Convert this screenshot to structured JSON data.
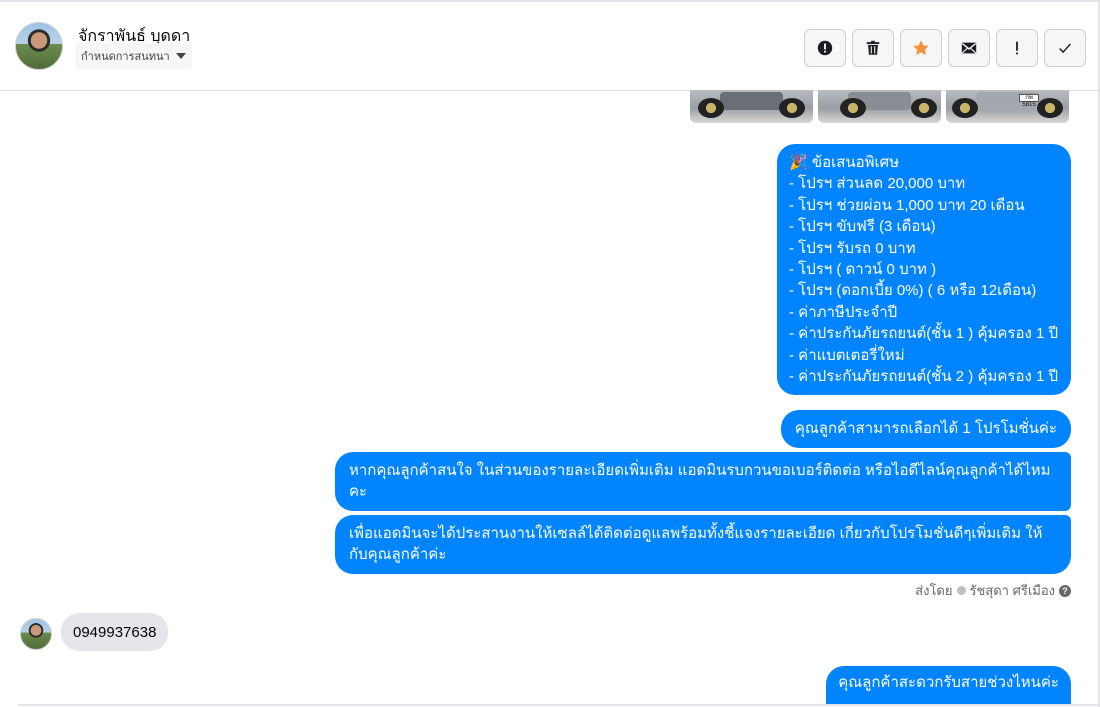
{
  "header": {
    "contact_name": "จักราพันธ์ บุดดา",
    "assign_label": "กำหนดการสนทนา",
    "actions": [
      {
        "name": "spam-button",
        "icon": "alert-circle-icon"
      },
      {
        "name": "delete-button",
        "icon": "trash-icon"
      },
      {
        "name": "star-button",
        "icon": "star-icon"
      },
      {
        "name": "mark-unread-button",
        "icon": "envelope-icon"
      },
      {
        "name": "follow-up-button",
        "icon": "exclamation-icon"
      },
      {
        "name": "done-button",
        "icon": "check-icon"
      }
    ]
  },
  "colors": {
    "outgoing_bubble": "#0084ff",
    "incoming_bubble": "#e4e6eb",
    "star": "#f7923a"
  },
  "offer_message": {
    "lines": [
      "🎉 ข้อเสนอพิเศษ",
      "- โปรฯ ส่วนลด 20,000 บาท",
      "- โปรฯ ช่วยผ่อน 1,000 บาท 20 เดือน",
      "- โปรฯ ขับฟรี (3 เดือน)",
      "- โปรฯ รับรถ 0 บาท",
      "- โปรฯ ( ดาวน์ 0 บาท )",
      "- โปรฯ (ดอกเบี้ย 0%) ( 6 หรือ 12เดือน)",
      "- ค่าภาษีประจำปี",
      "- ค่าประกันภัยรถยนต์(ชั้น 1 ) คุ้มครอง 1 ปี",
      "- ค่าแบตเตอรี่ใหม่",
      "- ค่าประกันภัยรถยนต์(ชั้น 2 ) คุ้มครอง 1 ปี"
    ]
  },
  "messages": {
    "choose_one": "คุณลูกค้าสามารถเลือกได้ 1 โปรโมชั่นค่ะ",
    "ask_contact": "หากคุณลูกค้าสนใจ ในส่วนของรายละเอียดเพิ่มเติม แอดมินรบกวนขอเบอร์ติดต่อ หรือไอดีไลน์คุณลูกค้าได้ไหมคะ",
    "coordinate_sales": "เพื่อแอดมินจะได้ประสานงานให้เซลล์ได้ติดต่อดูแลพร้อมทั้งชี้แจงรายละเอียด เกี่ยวกับโปรโมชั่นดีๆเพิ่มเติม ให้กับคุณลูกค้าค่ะ",
    "sent_by_label": "ส่งโดย",
    "sent_by_name": "รัชสุดา ศรีเมือง",
    "incoming_phone": "0949937638",
    "ask_time": "คุณลูกค้าสะดวกรับสายช่วงไหนค่ะ"
  },
  "attachments": [
    {
      "name": "car-photo-1"
    },
    {
      "name": "car-photo-2"
    },
    {
      "name": "car-photo-3",
      "plate_text": "กพ 5815"
    }
  ]
}
